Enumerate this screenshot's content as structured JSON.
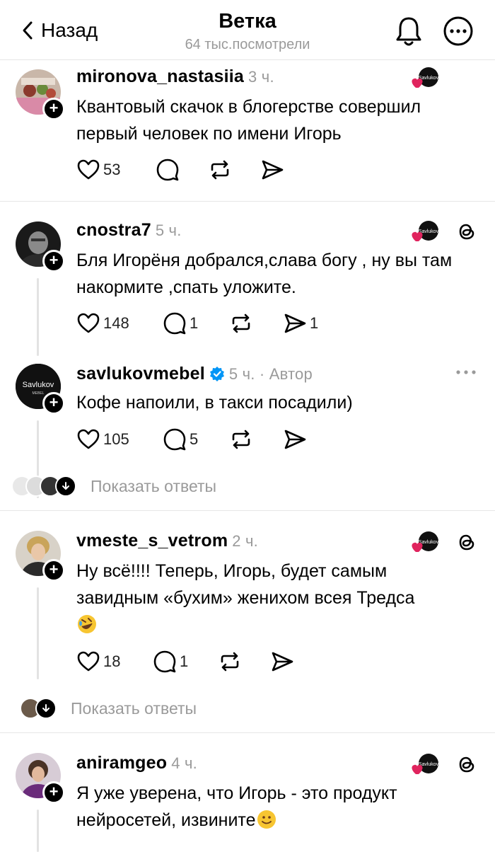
{
  "header": {
    "back_label": "Назад",
    "title": "Ветка",
    "subtitle": "64 тыс.посмотрели"
  },
  "posts": [
    {
      "username": "mironova_nastasiia",
      "time": "3 ч.",
      "text": "Квантовый скачок в блогерстве совершил первый человек по имени Игорь",
      "likes": "53",
      "replies": "",
      "reposts": "",
      "shares": ""
    },
    {
      "username": "cnostra7",
      "time": "5 ч.",
      "text": "Бля Игорёня добрался,слава богу , ну вы там накормите ,спать уложите.",
      "likes": "148",
      "replies": "1",
      "reposts": "",
      "shares": "1"
    },
    {
      "username": "savlukovmebel",
      "time": "5 ч. · Автор",
      "text": "Кофе напоили, в такси посадили)",
      "likes": "105",
      "replies": "5",
      "reposts": "",
      "shares": "",
      "avatar_text": "Savlukov",
      "avatar_subtext": "MEBEL"
    },
    {
      "username": "vmeste_s_vetrom",
      "time": "2 ч.",
      "text": "Ну всё!!!! Теперь, Игорь, будет самым завидным «бухим» женихом всея Тредса",
      "likes": "18",
      "replies": "1",
      "reposts": "",
      "shares": ""
    },
    {
      "username": "aniramgeo",
      "time": "4 ч.",
      "text": "Я уже уверена, что Игорь - это продукт нейросетей, извините"
    }
  ],
  "show_replies_label": "Показать ответы",
  "brand_badge_text": "Savlukov",
  "icons": {
    "heart": "heart-icon",
    "reply": "reply-icon",
    "repost": "repost-icon",
    "share": "share-icon",
    "threads": "threads-icon"
  },
  "colors": {
    "text": "#000000",
    "muted": "#9a9a9a",
    "heart_red": "#e0245e",
    "verified_blue": "#0095f6",
    "divider": "#e6e6e6"
  }
}
